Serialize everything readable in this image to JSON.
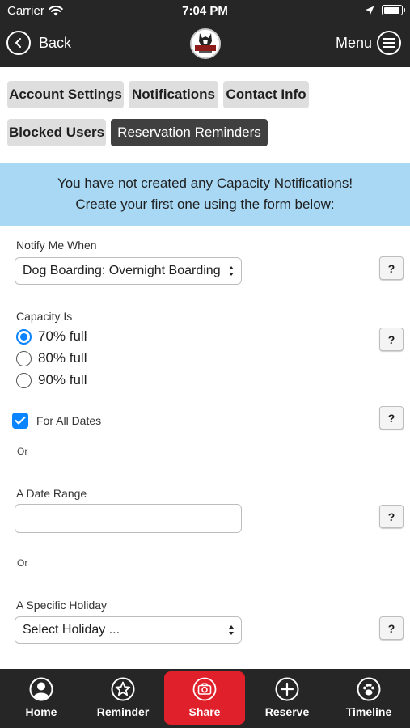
{
  "status_bar": {
    "carrier": "Carrier",
    "time": "7:04 PM",
    "battery_level": 0.95
  },
  "nav": {
    "back_label": "Back",
    "menu_label": "Menu"
  },
  "tabs": [
    {
      "label": "Account Settings",
      "active": false
    },
    {
      "label": "Notifications",
      "active": false
    },
    {
      "label": "Contact Info",
      "active": false
    },
    {
      "label": "Blocked Users",
      "active": false
    },
    {
      "label": "Reservation Reminders",
      "active": true
    }
  ],
  "banner": {
    "line1": "You have not created any Capacity Notifications!",
    "line2": "Create your first one using the form below:"
  },
  "form": {
    "notify_label": "Notify Me When",
    "notify_value": "Dog Boarding: Overnight Boarding",
    "capacity_label": "Capacity Is",
    "capacity_options": [
      {
        "label": "70% full",
        "selected": true
      },
      {
        "label": "80% full",
        "selected": false
      },
      {
        "label": "90% full",
        "selected": false
      }
    ],
    "all_dates_label": "For All Dates",
    "all_dates_checked": true,
    "or1": "Or",
    "date_range_label": "A Date Range",
    "date_range_value": "",
    "or2": "Or",
    "holiday_label": "A Specific Holiday",
    "holiday_value": "Select Holiday ...",
    "help_label": "?"
  },
  "bottom_nav": [
    {
      "label": "Home",
      "icon": "person-circle-icon"
    },
    {
      "label": "Reminder",
      "icon": "star-circle-icon"
    },
    {
      "label": "Share",
      "icon": "camera-icon"
    },
    {
      "label": "Reserve",
      "icon": "plus-circle-icon"
    },
    {
      "label": "Timeline",
      "icon": "paw-circle-icon"
    }
  ],
  "colors": {
    "bar_dark": "#262626",
    "banner_blue": "#a8d8f4",
    "share_red": "#e0202a",
    "accent_blue": "#0a84ff",
    "tab_gray": "#dedede",
    "tab_active": "#404040"
  }
}
